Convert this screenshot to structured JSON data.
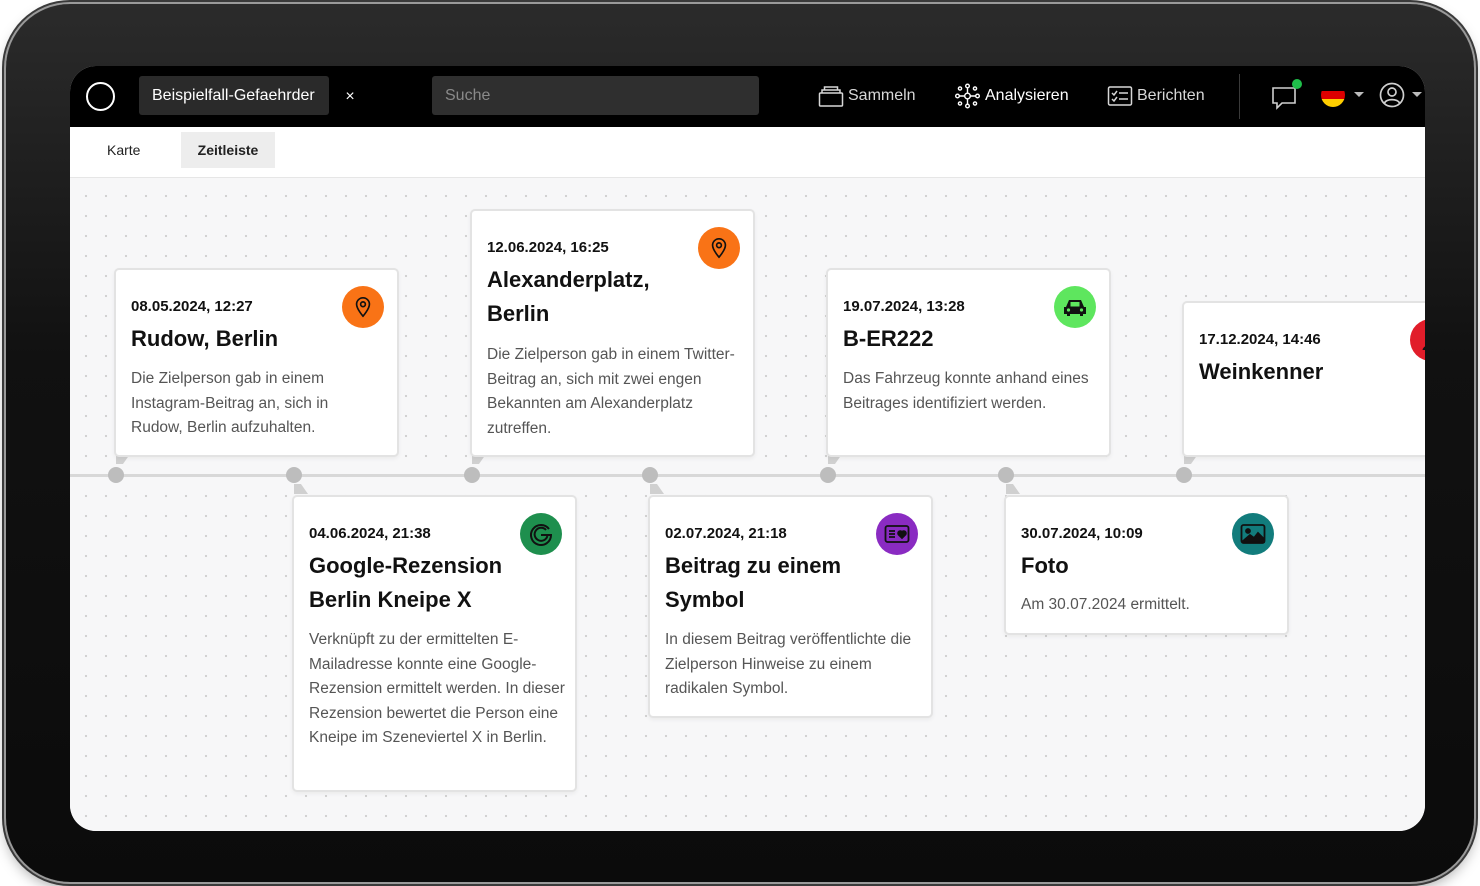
{
  "topbar": {
    "case_name": "Beispielfall-Gefaehrder",
    "close_symbol": "×",
    "search_placeholder": "Suche",
    "nav": [
      {
        "label": "Sammeln",
        "icon": "collect-icon"
      },
      {
        "label": "Analysieren",
        "icon": "analyze-icon"
      },
      {
        "label": "Berichten",
        "icon": "report-icon"
      }
    ],
    "notification_color": "#1fbf4a",
    "language": "de"
  },
  "subtabs": {
    "items": [
      "Karte",
      "Zeitleiste"
    ],
    "active": "Zeitleiste"
  },
  "events": [
    {
      "date": "08.05.2024, 12:27",
      "title": "Rudow, Berlin",
      "description": "Die Zielperson gab in einem Instagram-Beitrag an, sich in Rudow, Berlin aufzuhalten.",
      "icon": "location-pin-icon",
      "color": "#f97316"
    },
    {
      "date": "04.06.2024, 21:38",
      "title": "Google-Rezension Berlin Kneipe X",
      "description": "Verknüpft zu der ermittelten E-Mailadresse konnte eine Google-Rezension ermittelt werden. In dieser Rezension bewertet die Person eine Kneipe im Szeneviertel X in Berlin.",
      "icon": "google-icon",
      "color": "#1e8f4e"
    },
    {
      "date": "12.06.2024, 16:25",
      "title": "Alexanderplatz, Berlin",
      "description": "Die Zielperson gab in einem Twitter-Beitrag an, sich mit zwei engen Bekannten am Alexanderplatz zutreffen.",
      "icon": "location-pin-icon",
      "color": "#f97316"
    },
    {
      "date": "02.07.2024, 21:18",
      "title": "Beitrag zu einem Symbol",
      "description": "In diesem Beitrag veröffentlichte die Zielperson Hinweise zu einem radikalen Symbol.",
      "icon": "post-symbol-icon",
      "color": "#8a2bc2"
    },
    {
      "date": "19.07.2024, 13:28",
      "title": "B-ER222",
      "description": "Das Fahrzeug konnte anhand eines Beitrages identifiziert werden.",
      "icon": "car-icon",
      "color": "#5ee65e"
    },
    {
      "date": "30.07.2024, 10:09",
      "title": "Foto",
      "description": "Am 30.07.2024 ermittelt.",
      "icon": "image-icon",
      "color": "#127c7c"
    },
    {
      "date": "17.12.2024, 14:46",
      "title": "Weinkenner",
      "description": "",
      "icon": "person-icon",
      "color": "#e11d2a"
    }
  ]
}
